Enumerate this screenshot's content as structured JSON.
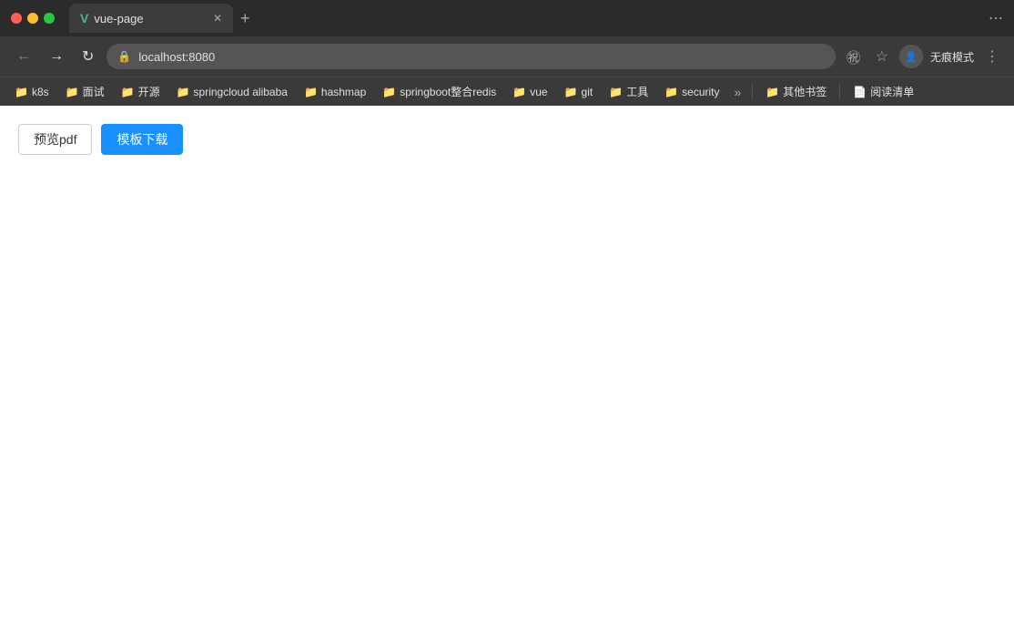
{
  "titlebar": {
    "tab_label": "vue-page",
    "tab_icon": "V",
    "new_tab_icon": "+",
    "window_action_icon": "⋯"
  },
  "navbar": {
    "back_icon": "←",
    "forward_icon": "→",
    "reload_icon": "↻",
    "url": "localhost:8080",
    "lock_icon": "🔒",
    "translate_icon": "A",
    "star_icon": "☆",
    "incognito_label": "无痕模式",
    "user_initials": "无痕",
    "more_icon": "⋮"
  },
  "bookmarks": {
    "items": [
      {
        "label": "k8s"
      },
      {
        "label": "面试"
      },
      {
        "label": "开源"
      },
      {
        "label": "springcloud alibaba"
      },
      {
        "label": "hashmap"
      },
      {
        "label": "springboot整合redis"
      },
      {
        "label": "vue"
      },
      {
        "label": "git"
      },
      {
        "label": "工具"
      },
      {
        "label": "security"
      }
    ],
    "more_label": "»",
    "other_bookmarks": "其他书签",
    "reading_list": "阅读清单"
  },
  "page": {
    "btn_preview": "预览pdf",
    "btn_download": "模板下载"
  }
}
